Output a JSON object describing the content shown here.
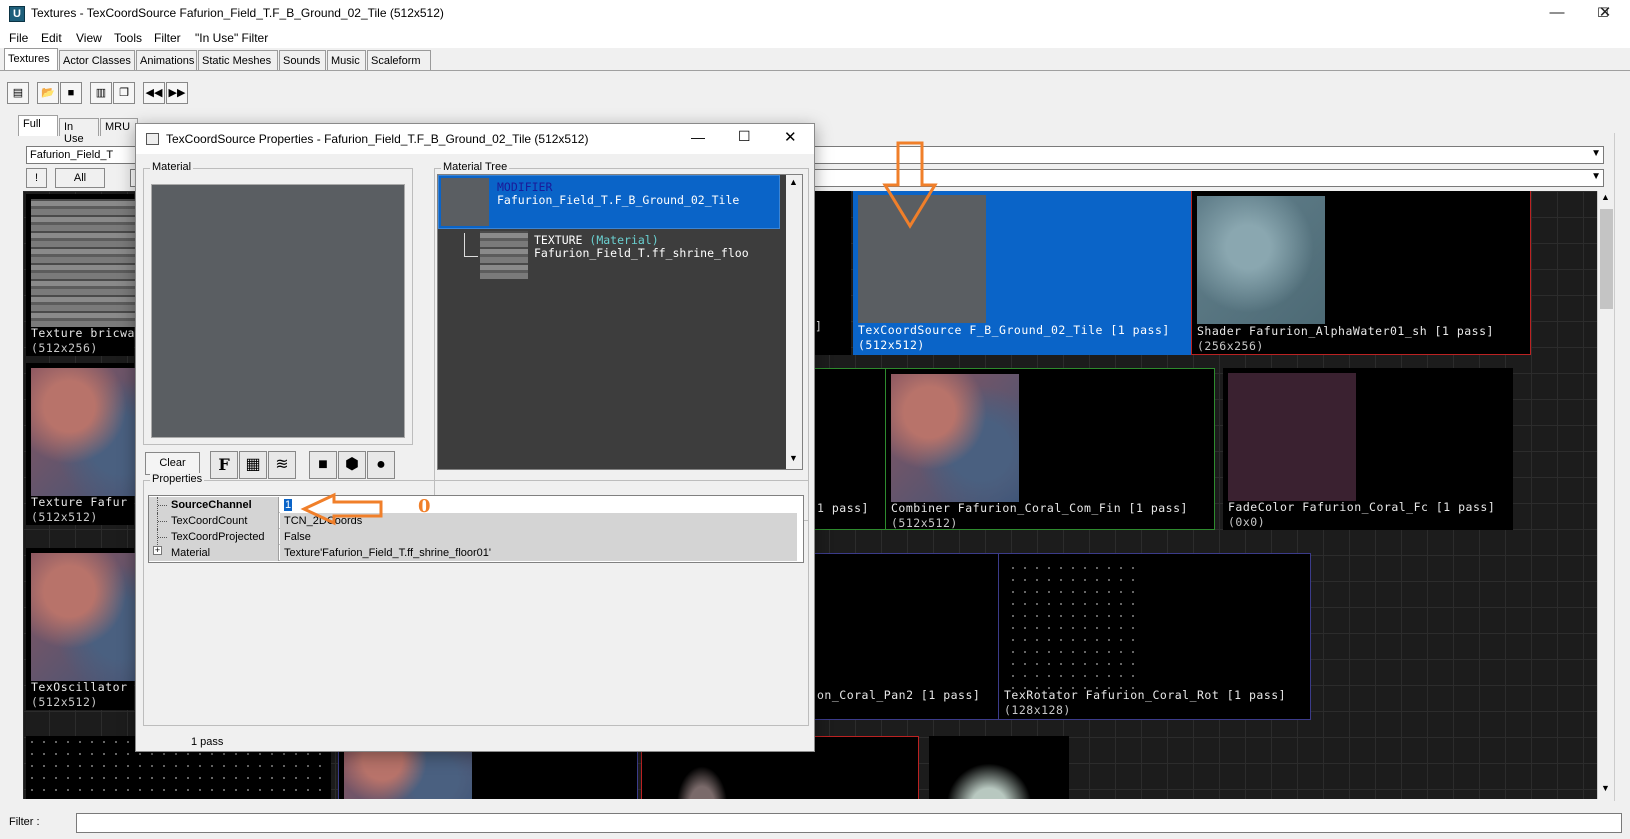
{
  "window": {
    "title": "Textures - TexCoordSource Fafurion_Field_T.F_B_Ground_02_Tile (512x512)",
    "minimize": "—",
    "maximize": "☐",
    "close": "✕"
  },
  "menu": [
    "File",
    "Edit",
    "View",
    "Tools",
    "Filter",
    "\"In Use\" Filter"
  ],
  "browser_tabs": [
    "Textures",
    "Actor Classes",
    "Animations",
    "Static Meshes",
    "Sounds",
    "Music",
    "Scaleform"
  ],
  "toolbar_icons": [
    "browser-icon",
    "open-folder-icon",
    "save-icon",
    "properties-icon",
    "copy-icon",
    "rewind-icon",
    "fast-forward-icon"
  ],
  "side_tabs": [
    "Full",
    "In Use",
    "MRU"
  ],
  "package_combo": "Fafurion_Field_T",
  "filter_buttons": [
    "!",
    "All"
  ],
  "tiles": [
    {
      "line1": "Texture bricwa",
      "line2": "(512x256)"
    },
    {
      "line1": "]",
      "line2": ""
    },
    {
      "line1": "TexCoordSource F_B_Ground_02_Tile [1 pass]",
      "line2": "(512x512)"
    },
    {
      "line1": "Shader Fafurion_AlphaWater01_sh [1 pass]",
      "line2": "(256x256)"
    },
    {
      "line1": "Texture Fafur",
      "line2": "(512x512)"
    },
    {
      "line1": "1 pass]",
      "line2": ""
    },
    {
      "line1": "Combiner Fafurion_Coral_Com_Fin [1 pass]",
      "line2": "(512x512)"
    },
    {
      "line1": "FadeColor Fafurion_Coral_Fc [1 pass]",
      "line2": "(0x0)"
    },
    {
      "line1": "TexOscillator",
      "line2": "(512x512)"
    },
    {
      "line1": "on_Coral_Pan2 [1 pass]",
      "line2": ""
    },
    {
      "line1": "TexRotator Fafurion_Coral_Rot [1 pass]",
      "line2": "(128x128)"
    }
  ],
  "filter": {
    "label": "Filter :",
    "value": ""
  },
  "dialog": {
    "title": "TexCoordSource Properties - Fafurion_Field_T.F_B_Ground_02_Tile (512x512)",
    "material_label": "Material",
    "tree_label": "Material Tree",
    "tree": [
      {
        "kind": "MODIFIER",
        "kind_suffix": "",
        "name": "Fafurion_Field_T.F_B_Ground_02_Tile"
      },
      {
        "kind": "TEXTURE",
        "kind_suffix": "(Material)",
        "name": "Fafurion_Field_T.ff_shrine_floo"
      }
    ],
    "clear_button": "Clear",
    "view_icons": [
      "font-f-icon",
      "checker-icon",
      "layers-icon",
      "square-icon",
      "shield-icon",
      "sphere-icon"
    ],
    "properties_label": "Properties",
    "properties": [
      {
        "name": "SourceChannel",
        "value": "1"
      },
      {
        "name": "TexCoordCount",
        "value": "TCN_2DCoords"
      },
      {
        "name": "TexCoordProjected",
        "value": "False"
      },
      {
        "name": "Material",
        "value": "Texture'Fafurion_Field_T.ff_shrine_floor01'"
      }
    ],
    "status": "1 pass",
    "annotation_value": "0"
  },
  "colors": {
    "selection": "#0a64c8",
    "annotation": "#f07f2a",
    "grid_bg": "#1c1c1c"
  }
}
